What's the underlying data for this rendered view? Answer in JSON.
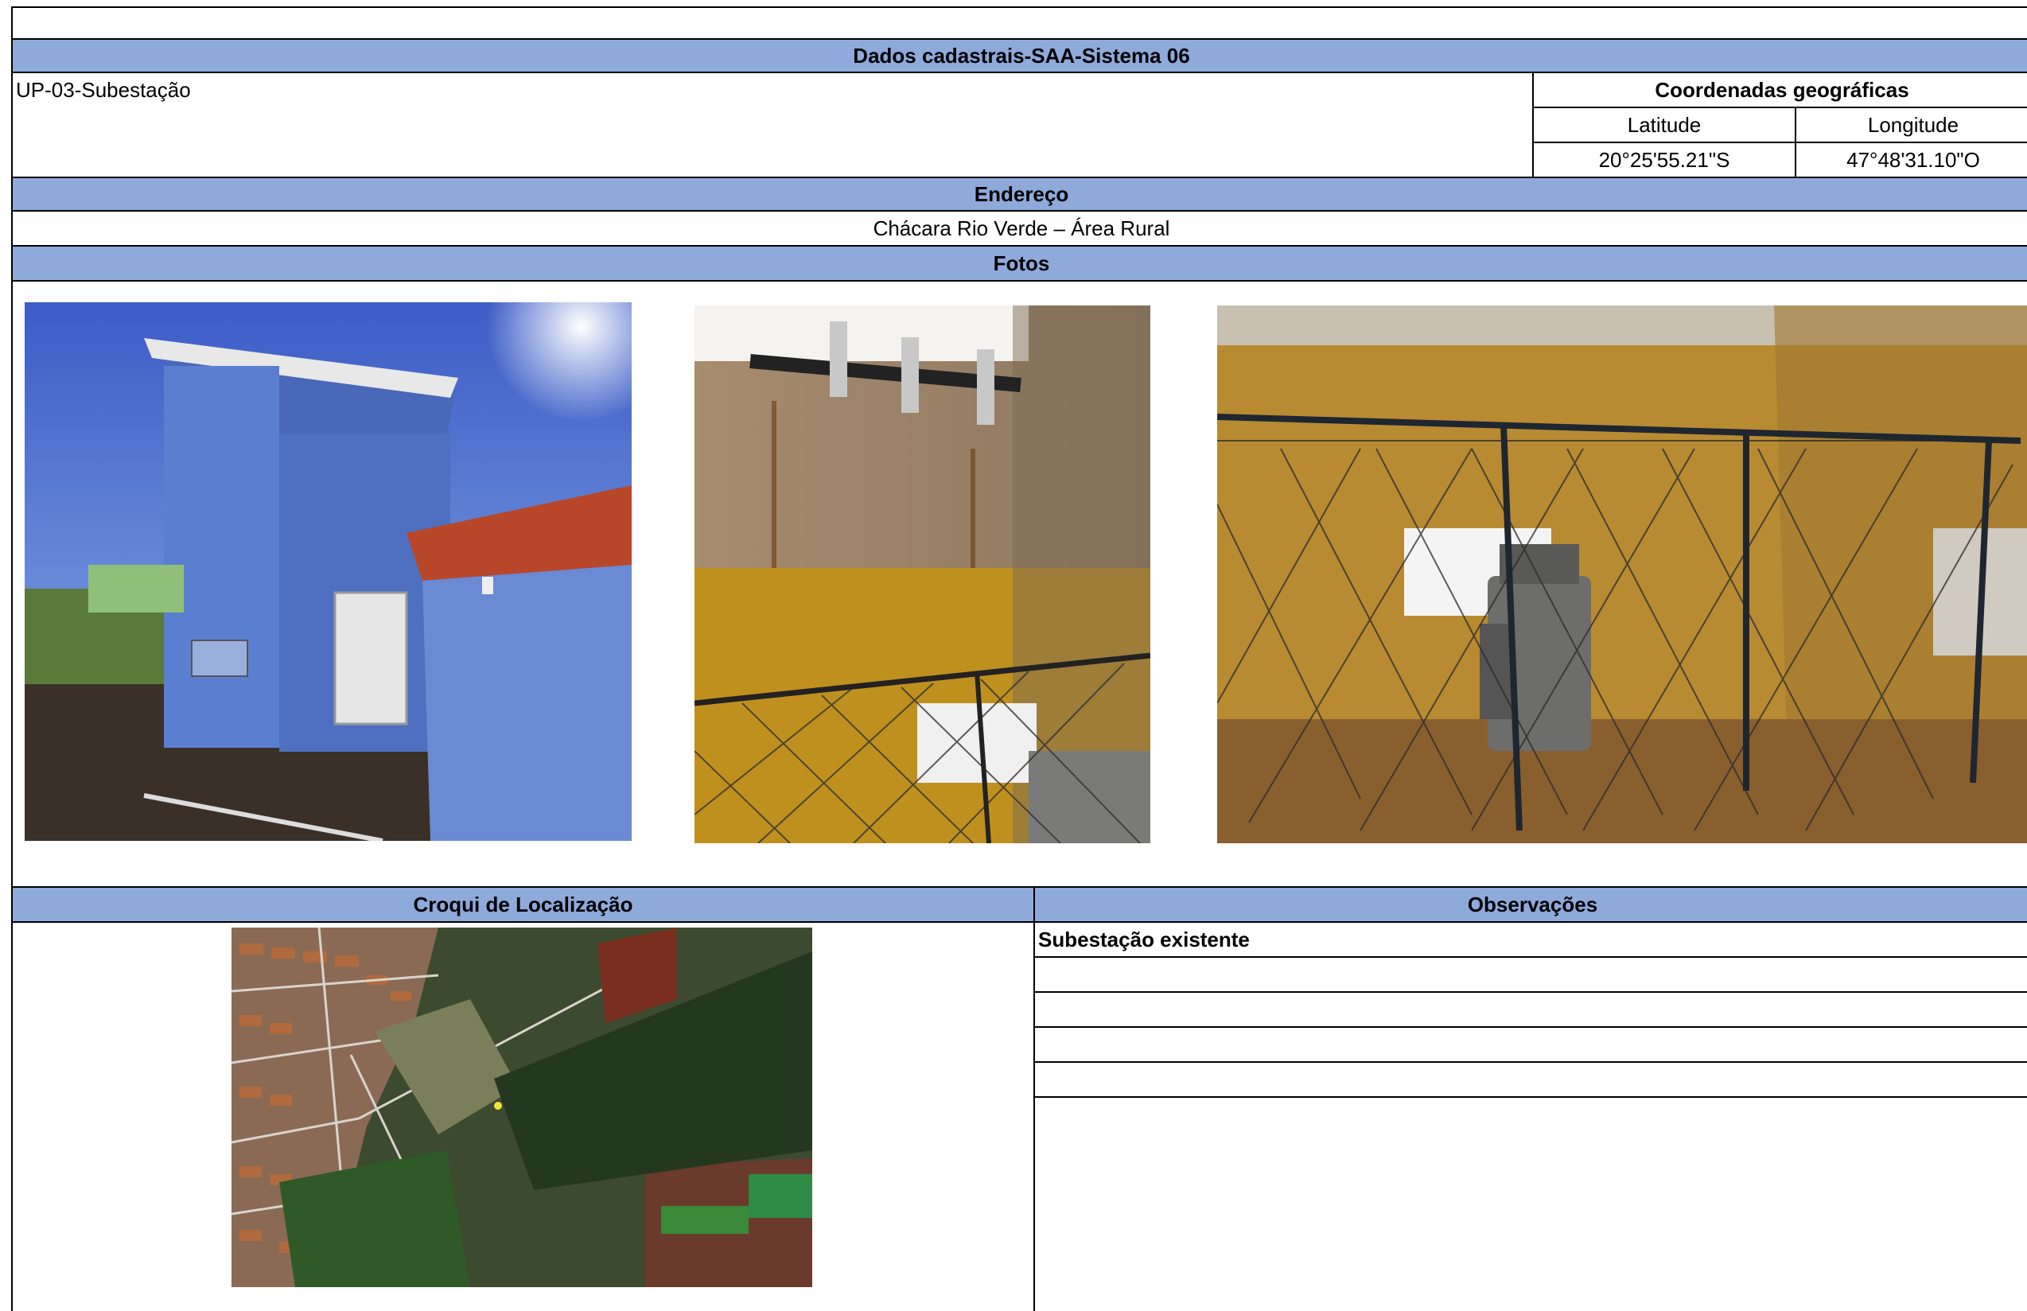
{
  "sheet": {
    "title": "Dados cadastrais-SAA-Sistema 06",
    "unit_name": "UP-03-Subestação",
    "coords": {
      "header": "Coordenadas geográficas",
      "lat_label": "Latitude",
      "lon_label": "Longitude",
      "lat_value": "20°25'55.21\"S",
      "lon_value": "47°48'31.10\"O"
    },
    "address": {
      "header": "Endereço",
      "value": "Chácara Rio Verde – Área Rural"
    },
    "photos_header": "Fotos",
    "map_header": "Croqui de Localização",
    "obs": {
      "header": "Observações",
      "lines": [
        "Subestação existente",
        "",
        "",
        "",
        ""
      ]
    }
  },
  "colors": {
    "header_fill": "#8eaadb",
    "border": "#000000"
  },
  "images": [
    {
      "name": "photo-substation-exterior",
      "desc_icon": "building-photo"
    },
    {
      "name": "photo-insulators-interior",
      "desc_icon": "interior-photo"
    },
    {
      "name": "photo-transformer-interior",
      "desc_icon": "transformer-photo"
    },
    {
      "name": "location-map",
      "desc_icon": "satellite-map"
    }
  ]
}
